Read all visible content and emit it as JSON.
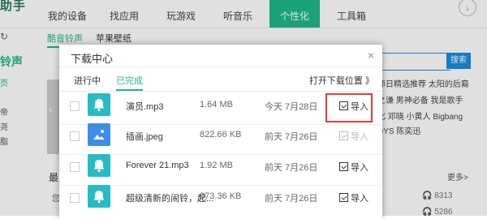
{
  "app": {
    "brand_fragment": "助手"
  },
  "nav": {
    "items": [
      {
        "label": "我的设备"
      },
      {
        "label": "找应用"
      },
      {
        "label": "玩游戏"
      },
      {
        "label": "听音乐"
      },
      {
        "label": "个性化"
      },
      {
        "label": "工具箱"
      }
    ],
    "active_index": 4
  },
  "subnav": {
    "tabs": [
      "酷音铃声",
      "苹果壁纸"
    ],
    "active_index": 0
  },
  "left_sidebar": {
    "title_fragment": "铃声",
    "item_fragments": [
      "页",
      "",
      "帝",
      "尧",
      "脂"
    ]
  },
  "search": {
    "button_label": "搜索",
    "placeholder": ""
  },
  "hot_tags": {
    "rows": [
      "师日精选推荐  太阳的后裔",
      "之谦  男神必备  我是歌手",
      "化  邓晓  小黄人  Bigbang",
      "DYS  陈奕迅"
    ]
  },
  "background": {
    "section_title_fragment": "最",
    "more_label": "更多>",
    "play_counts": [
      "8313",
      "5286"
    ],
    "left_fragment": "您"
  },
  "dialog": {
    "title": "下载中心",
    "close_label": "×",
    "tabs": [
      "进行中",
      "已完成"
    ],
    "active_tab_index": 1,
    "open_location_label": "打开下载位置 》",
    "files": [
      {
        "name": "演员.mp3",
        "size": "1.64 MB",
        "date": "今天 7月28日",
        "type": "bell",
        "import_label": "导入",
        "import_enabled": true
      },
      {
        "name": "插画.jpeg",
        "size": "822.66 KB",
        "date": "前天 7月26日",
        "type": "image",
        "import_label": "导入",
        "import_enabled": false
      },
      {
        "name": "Forever 21.mp3",
        "size": "1.92 MB",
        "date": "前天 7月26日",
        "type": "bell",
        "import_label": "导入",
        "import_enabled": true
      },
      {
        "name": "超级清新的闹铃，起...",
        "size": "673.36 KB",
        "date": "前天 7月26日",
        "type": "bell",
        "import_label": "导入",
        "import_enabled": true
      }
    ]
  },
  "colors": {
    "accent": "#1fb98a",
    "search_blue": "#1a8ce0",
    "file_icon": "#26bcc4",
    "highlight": "#e23b3b"
  }
}
